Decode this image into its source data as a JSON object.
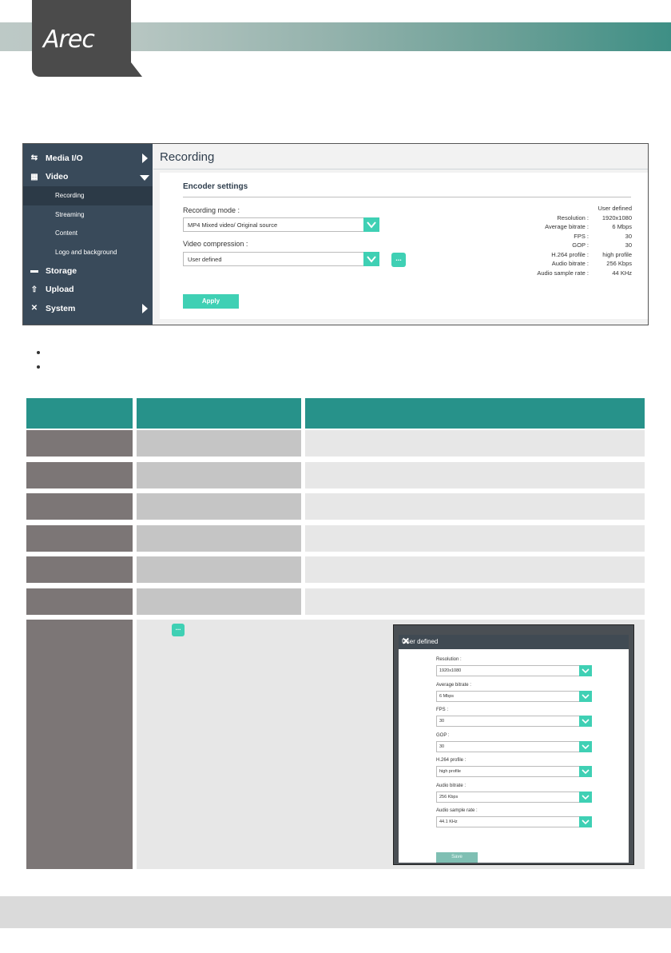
{
  "header": {
    "logo_text": "Arec"
  },
  "sidebar": {
    "items": [
      {
        "label": "Media I/O",
        "icon": "media-io-icon"
      },
      {
        "label": "Video",
        "icon": "film-icon"
      },
      {
        "label": "Recording"
      },
      {
        "label": "Streaming"
      },
      {
        "label": "Content"
      },
      {
        "label": "Logo and background"
      },
      {
        "label": "Storage",
        "icon": "storage-icon"
      },
      {
        "label": "Upload",
        "icon": "upload-icon"
      },
      {
        "label": "System",
        "icon": "tools-icon"
      }
    ]
  },
  "main": {
    "title": "Recording",
    "encoder_title": "Encoder settings",
    "recording_mode_label": "Recording mode :",
    "recording_mode_value": "MP4 Mixed video/ Original source",
    "video_compression_label": "Video compression :",
    "video_compression_value": "User defined",
    "more_button": "...",
    "apply_button": "Apply",
    "info_header": "User defined",
    "info": [
      {
        "key": "Resolution :",
        "value": "1920x1080"
      },
      {
        "key": "Average bitrate :",
        "value": "6 Mbps"
      },
      {
        "key": "FPS :",
        "value": "30"
      },
      {
        "key": "GOP :",
        "value": "30"
      },
      {
        "key": "H.264 profile :",
        "value": "high profile"
      },
      {
        "key": "Audio bitrate :",
        "value": "256 Kbps"
      },
      {
        "key": "Audio sample rate :",
        "value": "44 KHz"
      }
    ]
  },
  "inline_button": "...",
  "dialog": {
    "title": "User defined",
    "close": "✕",
    "fields": [
      {
        "label": "Resolution :",
        "value": "1920x1080"
      },
      {
        "label": "Average bitrate :",
        "value": "6 Mbps"
      },
      {
        "label": "FPS :",
        "value": "30"
      },
      {
        "label": "GOP :",
        "value": "30"
      },
      {
        "label": "H.264 profile :",
        "value": "high profile"
      },
      {
        "label": "Audio bitrate :",
        "value": "256 Kbps"
      },
      {
        "label": "Audio sample rate :",
        "value": "44.1 KHz"
      }
    ],
    "save_button": "Save"
  },
  "colors": {
    "accent": "#3fd0b4",
    "sidebar": "#394a5a",
    "table_header": "#27928a"
  }
}
